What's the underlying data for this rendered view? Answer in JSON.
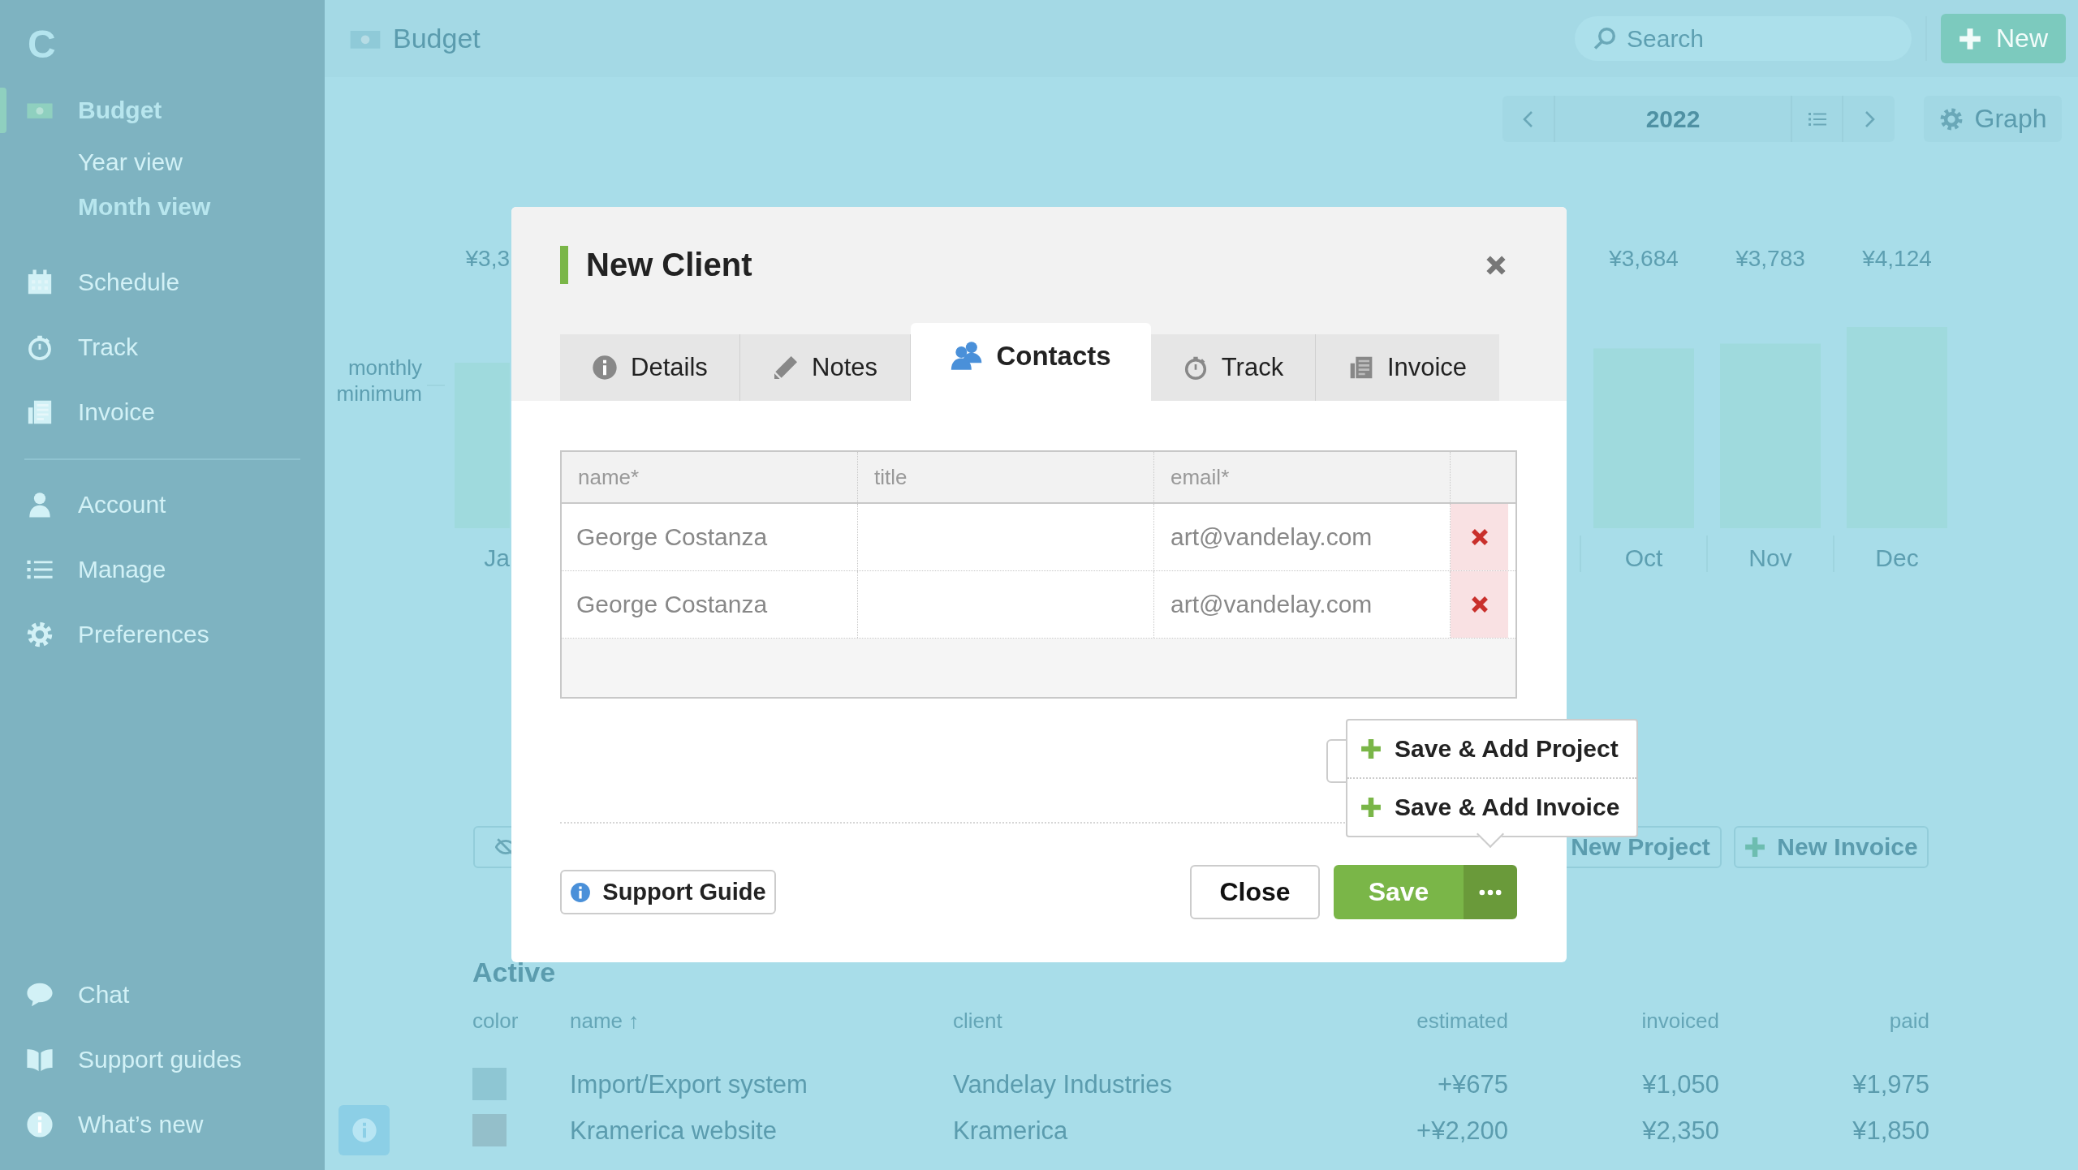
{
  "sidebar": {
    "logo": "C",
    "groups": [
      [
        {
          "label": "Budget",
          "selected": true,
          "children": [
            {
              "label": "Year view",
              "selected": false
            },
            {
              "label": "Month view",
              "selected": true
            }
          ]
        },
        {
          "label": "Schedule",
          "selected": false
        },
        {
          "label": "Track",
          "selected": false
        },
        {
          "label": "Invoice",
          "selected": false
        }
      ],
      [
        {
          "label": "Account",
          "selected": false
        },
        {
          "label": "Manage",
          "selected": false
        },
        {
          "label": "Preferences",
          "selected": false
        }
      ]
    ],
    "footer_items": [
      {
        "label": "Chat"
      },
      {
        "label": "Support guides"
      },
      {
        "label": "What’s new"
      }
    ]
  },
  "topbar": {
    "title": "Budget",
    "search": {
      "placeholder": "Search"
    },
    "new_button": "New"
  },
  "toolbar": {
    "period": "2022",
    "graph_button": "Graph"
  },
  "chart": {
    "axis_label_lines": [
      "monthly",
      "minimum"
    ],
    "partial_value_label": "¥3,3",
    "partial_month_label": "Ja",
    "chart_data": {
      "type": "bar",
      "categories": [
        "Oct",
        "Nov",
        "Dec"
      ],
      "values": [
        3684,
        3783,
        4124
      ],
      "value_labels": [
        "¥3,684",
        "¥3,783",
        "¥4,124"
      ]
    }
  },
  "actions": [
    "New Project",
    "New Invoice"
  ],
  "active": {
    "title": "Active",
    "columns": [
      "color",
      "name ↑",
      "client",
      "estimated",
      "invoiced",
      "paid"
    ],
    "rows": [
      {
        "color": "#8ec6d3",
        "name": "Import/Export system",
        "client": "Vandelay Industries",
        "estimated": "+¥675",
        "invoiced": "¥1,050",
        "paid": "¥1,975"
      },
      {
        "color": "#94bfca",
        "name": "Kramerica website",
        "client": "Kramerica",
        "estimated": "+¥2,200",
        "invoiced": "¥2,350",
        "paid": "¥1,850"
      }
    ]
  },
  "modal": {
    "title": "New Client",
    "tabs": [
      {
        "label": "Details",
        "selected": false
      },
      {
        "label": "Notes",
        "selected": false
      },
      {
        "label": "Contacts",
        "selected": true
      },
      {
        "label": "Track",
        "selected": false
      },
      {
        "label": "Invoice",
        "selected": false
      }
    ],
    "columns": [
      "name*",
      "title",
      "email*"
    ],
    "rows": [
      {
        "name": "George Costanza",
        "email": "art@vandelay.com"
      },
      {
        "name": "George Costanza",
        "email": "art@vandelay.com"
      }
    ],
    "menu": [
      "Save & Add Project",
      "Save & Add Invoice"
    ],
    "support_button": "Support Guide",
    "close_button": "Close",
    "save_button": "Save"
  }
}
